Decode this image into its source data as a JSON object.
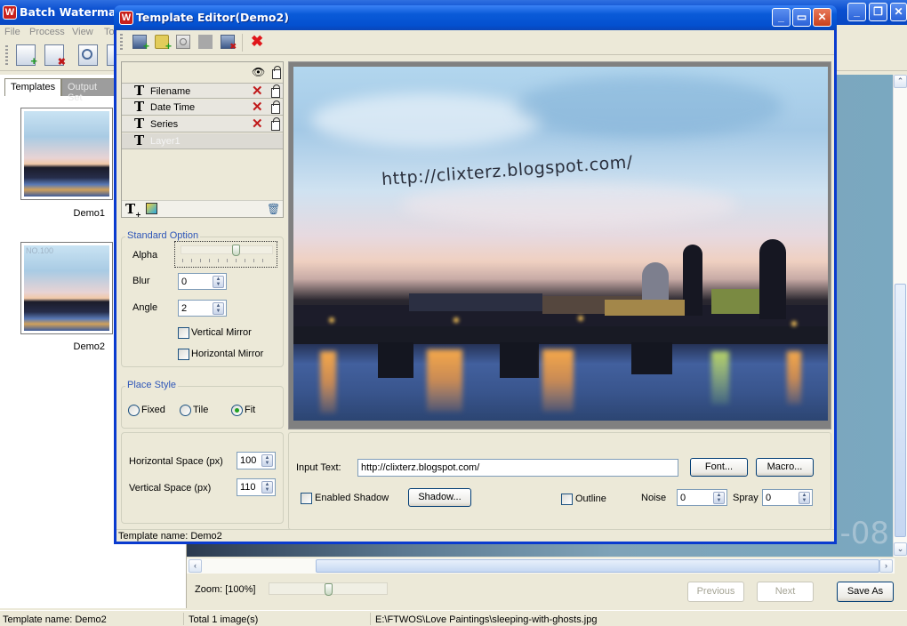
{
  "main_window": {
    "title": "Batch Watermark",
    "menu": [
      "File",
      "Process",
      "View",
      "To"
    ],
    "tabs": [
      {
        "label": "Templates",
        "active": true
      },
      {
        "label": "Output Set",
        "active": false
      }
    ],
    "templates": [
      {
        "label": "Demo1",
        "overlay_text": ""
      },
      {
        "label": "Demo2",
        "overlay_text": "NO.100"
      }
    ],
    "background_image_text": "-08",
    "zoom": {
      "label": "Zoom: [100%]",
      "value_percent": 100
    },
    "buttons": {
      "previous": "Previous",
      "next": "Next",
      "save_as": "Save As"
    },
    "status": {
      "template_name": "Template name: Demo2",
      "total": "Total 1 image(s)",
      "path": "E:\\FTWOS\\Love Paintings\\sleeping-with-ghosts.jpg"
    }
  },
  "dialog": {
    "title": "Template Editor(Demo2)",
    "toolbar": [
      {
        "name": "new-template-icon"
      },
      {
        "name": "open-folder-icon"
      },
      {
        "name": "preview-icon"
      },
      {
        "name": "disabled-icon"
      },
      {
        "name": "delete-image-icon"
      },
      {
        "name": "close-red-x-icon"
      }
    ],
    "layers": [
      {
        "label": "Filename",
        "removable": true,
        "locked": true
      },
      {
        "label": "Date Time",
        "removable": true,
        "locked": true
      },
      {
        "label": "Series",
        "removable": true,
        "locked": true
      },
      {
        "label": "Layer1",
        "selected": true
      }
    ],
    "standard_option": {
      "title": "Standard Option",
      "alpha_label": "Alpha",
      "alpha_fraction": 0.6,
      "blur_label": "Blur",
      "blur_value": "0",
      "angle_label": "Angle",
      "angle_value": "2",
      "vertical_mirror": "Vertical Mirror",
      "horizontal_mirror": "Horizontal Mirror"
    },
    "place_style": {
      "title": "Place Style",
      "options": [
        "Fixed",
        "Tile",
        "Fit"
      ],
      "selected": "Fit"
    },
    "spacing": {
      "horizontal_label": "Horizontal Space (px)",
      "horizontal_value": "100",
      "vertical_label": "Vertical Space (px)",
      "vertical_value": "110"
    },
    "watermark_text": "http://clixterz.blogspot.com/",
    "input_text_label": "Input Text:",
    "input_text_value": "http://clixterz.blogspot.com/",
    "font_button": "Font...",
    "macro_button": "Macro...",
    "enabled_shadow": "Enabled Shadow",
    "shadow_button": "Shadow...",
    "outline": "Outline",
    "noise_label": "Noise",
    "noise_value": "0",
    "spray_label": "Spray",
    "spray_value": "0",
    "status": "Template name: Demo2"
  },
  "colors": {
    "title_blue": "#0a5bd8",
    "panel_bg": "#ece9d8",
    "group_label": "#2e56b8",
    "delete_red": "#c0191a"
  }
}
